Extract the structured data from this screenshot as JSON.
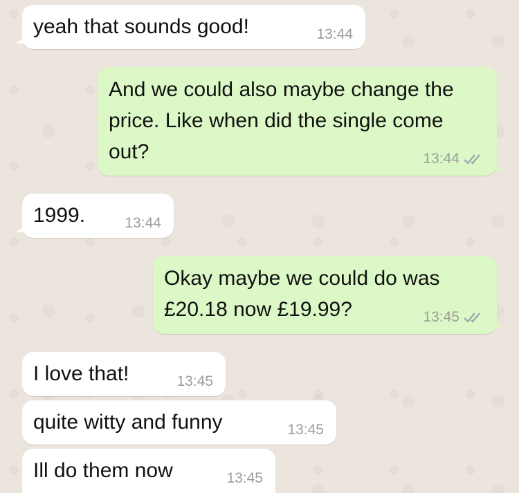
{
  "messages": [
    {
      "dir": "in",
      "text": "yeah that sounds good!",
      "time": "13:44"
    },
    {
      "dir": "out",
      "text": "And we could also maybe change the price. Like when did the single come out?",
      "time": "13:44",
      "status": "read-ticks-icon"
    },
    {
      "dir": "in",
      "text": "1999.",
      "time": "13:44"
    },
    {
      "dir": "out",
      "text": "Okay maybe we could do was £20.18 now £19.99?",
      "time": "13:45",
      "status": "read-ticks-icon"
    },
    {
      "dir": "in",
      "text": "I love that!",
      "time": "13:45"
    },
    {
      "dir": "in",
      "text": "quite witty and funny",
      "time": "13:45"
    },
    {
      "dir": "in",
      "text": "Ill do them now",
      "time": "13:45"
    }
  ],
  "colors": {
    "background": "#ece5dd",
    "incoming_bubble": "#ffffff",
    "outgoing_bubble": "#dcf8c6",
    "timestamp": "#9c9c9c",
    "tick": "#9aa3ad"
  }
}
